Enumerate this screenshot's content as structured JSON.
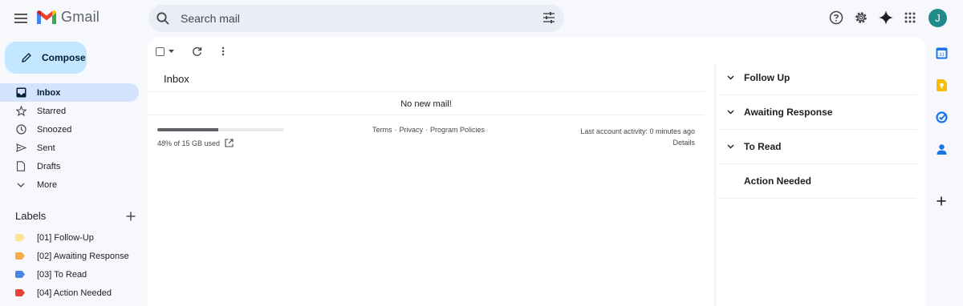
{
  "header": {
    "app_name": "Gmail",
    "search_placeholder": "Search mail",
    "avatar_initial": "J",
    "icons": [
      "menu-icon",
      "gmail-logo",
      "search-icon",
      "search-options-icon",
      "help-icon",
      "settings-icon",
      "gemini-icon",
      "apps-icon"
    ]
  },
  "sidebar": {
    "compose_label": "Compose",
    "items": [
      {
        "label": "Inbox",
        "icon": "inbox-icon",
        "active": true
      },
      {
        "label": "Starred",
        "icon": "star-icon"
      },
      {
        "label": "Snoozed",
        "icon": "clock-icon"
      },
      {
        "label": "Sent",
        "icon": "send-icon"
      },
      {
        "label": "Drafts",
        "icon": "draft-icon"
      },
      {
        "label": "More",
        "icon": "chevron-down-icon"
      }
    ],
    "labels_title": "Labels",
    "labels": [
      {
        "label": "[01] Follow-Up",
        "color": "#fde293"
      },
      {
        "label": "[02] Awaiting Response",
        "color": "#f6ae4a"
      },
      {
        "label": "[03] To Read",
        "color": "#4a86e8"
      },
      {
        "label": "[04] Action Needed",
        "color": "#ea4335"
      }
    ]
  },
  "main": {
    "inbox_title": "Inbox",
    "empty_message": "No new mail!",
    "storage": {
      "text": "48% of 15 GB used",
      "fraction": 0.48
    },
    "footer_links": [
      "Terms",
      "·",
      "Privacy",
      "·",
      "Program Policies"
    ],
    "activity_text": "Last account activity: 0 minutes ago",
    "details_label": "Details"
  },
  "sections": [
    {
      "label": "Follow Up",
      "chevron": true
    },
    {
      "label": "Awaiting Response",
      "chevron": true
    },
    {
      "label": "To Read",
      "chevron": true
    },
    {
      "label": "Action Needed",
      "chevron": false
    }
  ],
  "rail": {
    "icons": [
      "calendar-icon",
      "keep-icon",
      "tasks-icon",
      "contacts-icon",
      "add-icon"
    ]
  },
  "colors": {
    "background": "#f6f8fc",
    "compose": "#c2e7ff",
    "active_nav": "#d3e3fd",
    "search": "#e9eef6",
    "avatar": "#1f8a8a"
  }
}
